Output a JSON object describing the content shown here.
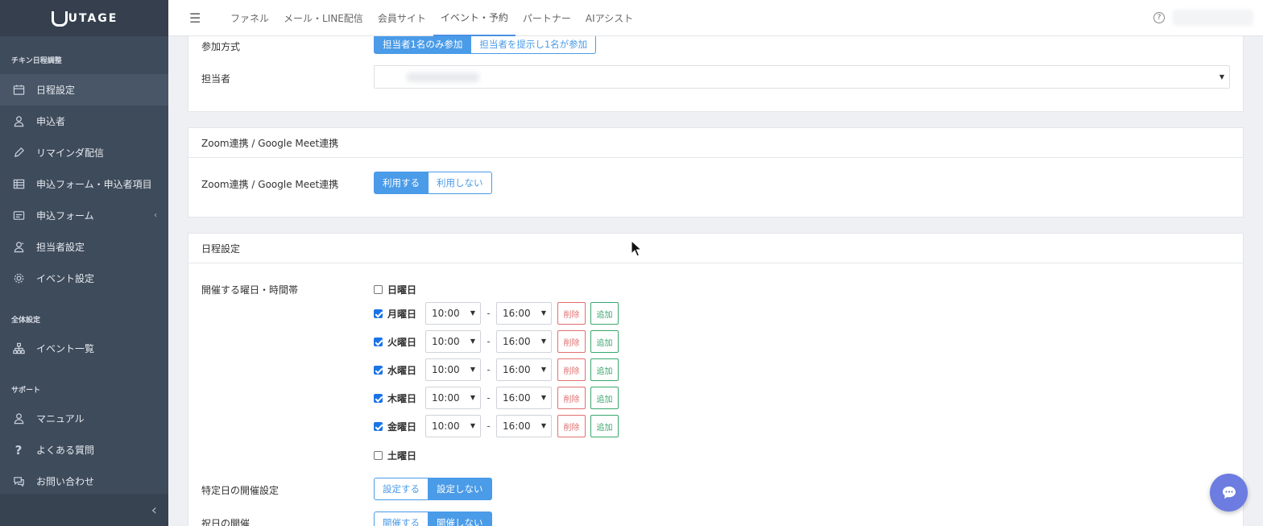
{
  "brand": {
    "logo_text": "UTAGE"
  },
  "sidebar": {
    "section1_title": "チキン日程調整",
    "items": [
      {
        "label": "日程設定",
        "icon": "calendar-icon",
        "active": true
      },
      {
        "label": "申込者",
        "icon": "user-icon"
      },
      {
        "label": "リマインダ配信",
        "icon": "pencil-icon"
      },
      {
        "label": "申込フォーム・申込者項目",
        "icon": "table-icon"
      },
      {
        "label": "申込フォーム",
        "icon": "form-icon",
        "caret": "‹"
      },
      {
        "label": "担当者設定",
        "icon": "staff-icon"
      },
      {
        "label": "イベント設定",
        "icon": "gear-icon"
      }
    ],
    "section2_title": "全体設定",
    "items2": [
      {
        "label": "イベント一覧",
        "icon": "sitemap-icon"
      }
    ],
    "section3_title": "サポート",
    "items3": [
      {
        "label": "マニュアル",
        "icon": "user-icon"
      },
      {
        "label": "よくある質問",
        "icon": "question-icon"
      },
      {
        "label": "お問い合わせ",
        "icon": "chat-icon"
      }
    ],
    "collapse_glyph": "‹"
  },
  "topbar": {
    "menu_glyph": "☰",
    "tabs": [
      "ファネル",
      "メール・LINE配信",
      "会員サイト",
      "イベント・予約",
      "パートナー",
      "AIアシスト"
    ],
    "active_tab": "イベント・予約",
    "help_glyph": "?"
  },
  "card1": {
    "participation_label": "参加方式",
    "participation_options": [
      "担当者1名のみ参加",
      "担当者を提示し1名が参加"
    ],
    "participation_selected": "担当者1名のみ参加",
    "staff_label": "担当者"
  },
  "card2": {
    "title": "Zoom連携 / Google Meet連携",
    "row_label": "Zoom連携 / Google Meet連携",
    "options": [
      "利用する",
      "利用しない"
    ],
    "selected": "利用する"
  },
  "card3": {
    "title": "日程設定",
    "days_label": "開催する曜日・時間帯",
    "days": [
      {
        "name": "日曜日",
        "checked": false
      },
      {
        "name": "月曜日",
        "checked": true,
        "start": "10:00",
        "end": "16:00"
      },
      {
        "name": "火曜日",
        "checked": true,
        "start": "10:00",
        "end": "16:00"
      },
      {
        "name": "水曜日",
        "checked": true,
        "start": "10:00",
        "end": "16:00"
      },
      {
        "name": "木曜日",
        "checked": true,
        "start": "10:00",
        "end": "16:00"
      },
      {
        "name": "金曜日",
        "checked": true,
        "start": "10:00",
        "end": "16:00"
      },
      {
        "name": "土曜日",
        "checked": false
      }
    ],
    "dash": "-",
    "delete_label": "削除",
    "add_label": "追加",
    "special_label": "特定日の開催設定",
    "special_options": [
      "設定する",
      "設定しない"
    ],
    "special_selected": "設定しない",
    "holiday_label": "祝日の開催",
    "holiday_options": [
      "開催する",
      "開催しない"
    ],
    "holiday_selected": "開催しない"
  },
  "colors": {
    "accent": "#4a9be8",
    "sidebar": "#3e4b5b",
    "delete": "#e07070",
    "add": "#3aa76d",
    "chat": "#6c7ce0"
  }
}
